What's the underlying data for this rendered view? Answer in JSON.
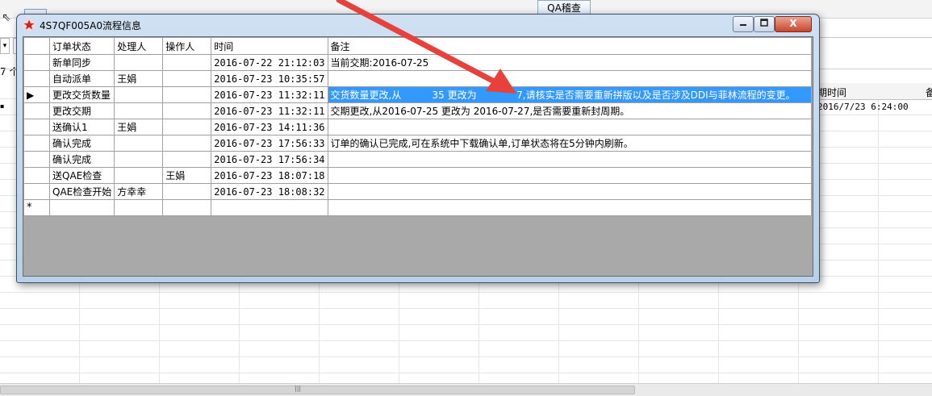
{
  "background": {
    "qa_button": "QA稽查",
    "row_count": "7 个",
    "grid_header_time": "期时间",
    "grid_header_note": "备",
    "grid_value": "2016/7/23 6:24:00"
  },
  "window": {
    "title": "4S7QF005A0流程信息",
    "close_label": "X",
    "columns": [
      "订单状态",
      "处理人",
      "操作人",
      "时间",
      "备注"
    ],
    "rows": [
      {
        "status": "新单同步",
        "handler": "",
        "operator": "",
        "time": "2016-07-22 21:12:03",
        "note": "当前交期:2016-07-25"
      },
      {
        "status": "自动派单",
        "handler": "王娟",
        "operator": "",
        "time": "2016-07-23 10:35:57",
        "note": ""
      },
      {
        "status": "更改交货数量",
        "handler": "",
        "operator": "",
        "time": "2016-07-23 11:32:11",
        "note": "交货数量更改,从          35 更改为             7,请核实是否需要重新拼版以及是否涉及DDI与菲林流程的变更。",
        "current": true
      },
      {
        "status": "更改交期",
        "handler": "",
        "operator": "",
        "time": "2016-07-23 11:32:11",
        "note": "交期更改,从2016-07-25 更改为 2016-07-27,是否需要重新封周期。"
      },
      {
        "status": "送确认1",
        "handler": "王娟",
        "operator": "",
        "time": "2016-07-23 14:11:36",
        "note": ""
      },
      {
        "status": "确认完成",
        "handler": "",
        "operator": "",
        "time": "2016-07-23 17:56:33",
        "note": "订单的确认已完成,可在系统中下载确认单,订单状态将在5分钟内刷新。"
      },
      {
        "status": "确认完成",
        "handler": "",
        "operator": "",
        "time": "2016-07-23 17:56:34",
        "note": ""
      },
      {
        "status": "送QAE检查",
        "handler": "",
        "operator": "王娟",
        "time": "2016-07-23 18:07:18",
        "note": ""
      },
      {
        "status": "QAE检查开始",
        "handler": "方幸幸",
        "operator": "",
        "time": "2016-07-23 18:08:32",
        "note": ""
      }
    ],
    "current_row_marker": "▶",
    "new_row_marker": "*"
  },
  "colors": {
    "selection": "#3399ff",
    "arrow": "#e8403a",
    "client_bg": "#a9a9a9"
  },
  "icons": {
    "window_icon": "red-star-icon",
    "minimize": "minimize-icon",
    "maximize": "maximize-icon",
    "close": "close-icon"
  }
}
